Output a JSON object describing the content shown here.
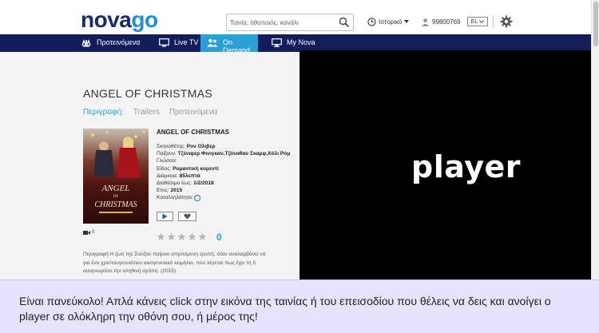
{
  "header": {
    "logo_part1": "nova",
    "logo_part2": "go",
    "search_placeholder": "Ταινία, ηθοποιός, κανάλι",
    "history_label": "Ιστορικό",
    "user_id": "99800769",
    "language": "EL"
  },
  "nav": {
    "items": [
      {
        "label": "Προτεινόμενα",
        "icon": "eye-hand-icon"
      },
      {
        "label": "Live TV",
        "icon": "tv-icon"
      },
      {
        "label": "On Demand",
        "icon": "people-icon"
      },
      {
        "label": "My Nova",
        "icon": "monitor-icon"
      }
    ],
    "active_index": 2
  },
  "movie": {
    "title": "ANGEL OF CHRISTMAS",
    "tabs": [
      "Περιγραφή:",
      "Trailers",
      "Προτεινόμενα"
    ],
    "info_title": "ANGEL OF CHRISTMAS",
    "director_label": "Σκηνοθέτης:",
    "director": "Ρον Ολιβερ",
    "cast_label": "Παίζουν:",
    "cast": "Τζένιφερ Φινιγκαν,Τζόναθαν Σκαρφ,Χόλι Ρόμ",
    "language_label": "Γλώσσα:",
    "genre_label": "Είδος:",
    "genre": "Ρομαντική κομεντί",
    "duration_label": "Διάρκεια:",
    "duration": "85λεπτά",
    "available_label": "Διαθέσιμο έως:",
    "available": "1/2/2018",
    "year_label": "Ετος:",
    "year": "2015",
    "rating_label": "Καταλληλότητα:",
    "camera_count": "0",
    "stars_filled": 0,
    "stars_total": 5,
    "rating_count": "0",
    "description_lines": [
      "Περιγραφή:Η ζωή της Σούζαν παίρνει απρόσμενη τροπή, όταν αναλαμβάνει να",
      "για ένα χριστουγεννιάτικο οικογενειακό κειμήλιο, που λέγεται πως έχει τη δ",
      "αναγνωρίσει την αληθινή αγάπη. (2015)"
    ],
    "poster_text_1": "ANGEL",
    "poster_text_2": "OF",
    "poster_text_3": "CHRISTMAS"
  },
  "player": {
    "label": "player"
  },
  "caption": {
    "text": "Είναι πανεύκολο! Απλά κάνεις click στην εικόνα της ταινίας ή του επεισοδίου που θέλεις να δεις και ανοίγει ο player σε ολόκληρη την οθόνη σου, ή μέρος της!"
  },
  "colors": {
    "nav_bg": "#131d5c",
    "nav_active": "#2a9fd8",
    "logo_dark": "#1b2a6b",
    "logo_light": "#1c8fd6",
    "caption_bg": "#e6e3fe"
  }
}
